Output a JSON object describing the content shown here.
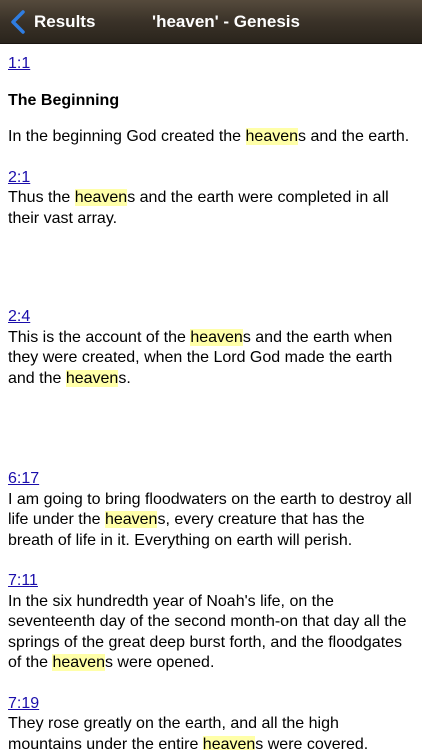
{
  "navbar": {
    "back_label": "Results",
    "title": "'heaven' - Genesis"
  },
  "verses": [
    {
      "ref": "1:1",
      "heading": "The Beginning",
      "pre": "In the beginning God created the ",
      "segments": [
        {
          "hl": "heaven",
          "after": "s and the earth."
        }
      ]
    },
    {
      "ref": "2:1",
      "pre": "Thus the ",
      "segments": [
        {
          "hl": "heaven",
          "after": "s and the earth were completed in all their vast array."
        }
      ]
    },
    {
      "ref": "2:4",
      "pre": "This is the account of the ",
      "segments": [
        {
          "hl": "heaven",
          "after": "s and the earth when they were created, when the Lord God made the earth and the "
        },
        {
          "hl": "heaven",
          "after": "s."
        }
      ]
    },
    {
      "ref": "6:17",
      "pre": "I am going to bring floodwaters on the earth to destroy all life under the ",
      "segments": [
        {
          "hl": "heaven",
          "after": "s, every creature that has the breath of life in it. Everything on earth will perish."
        }
      ]
    },
    {
      "ref": "7:11",
      "pre": "In the six hundredth year of Noah's life, on the seventeenth day of the second month-on that day all the springs of the great deep burst forth, and the floodgates of the ",
      "segments": [
        {
          "hl": "heaven",
          "after": "s were opened."
        }
      ]
    },
    {
      "ref": "7:19",
      "pre": "They rose greatly on the earth, and all the high mountains under the entire ",
      "segments": [
        {
          "hl": "heaven",
          "after": "s were covered."
        }
      ]
    }
  ],
  "icons": {
    "back": "chevron-left-icon"
  },
  "colors": {
    "navbar": "#3a3228",
    "link": "#1a0dab",
    "highlight": "#ffffa8",
    "back_chevron": "#2f7de1"
  }
}
